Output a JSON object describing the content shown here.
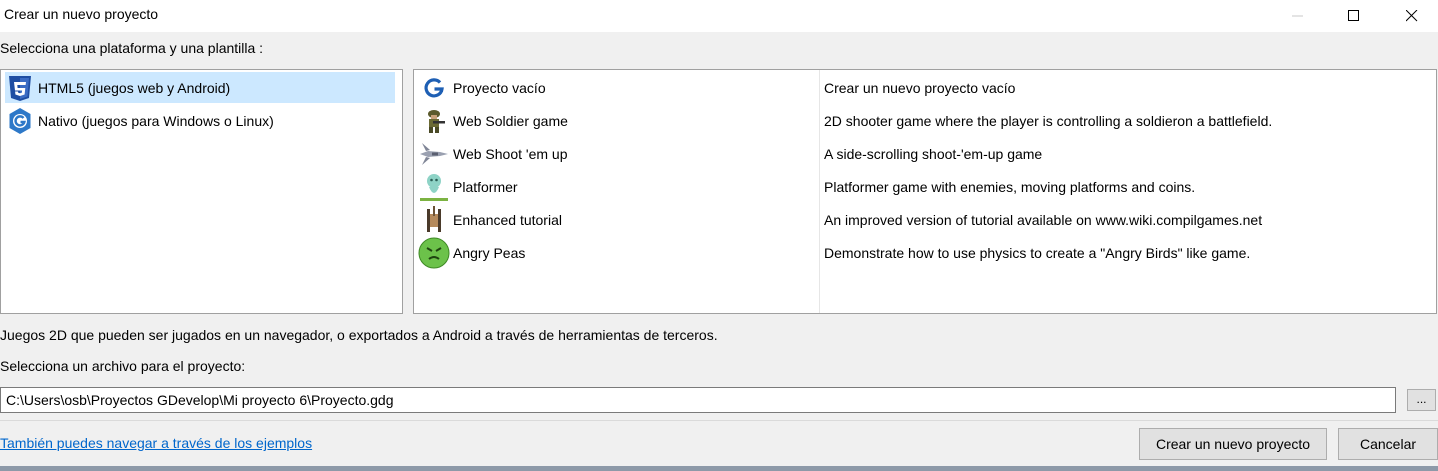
{
  "window": {
    "title": "Crear un nuevo proyecto"
  },
  "labels": {
    "choose_platform": "Selecciona una plataforma y una plantilla :",
    "platform_description": "Juegos 2D que pueden ser jugados en un navegador, o exportados a Android a través de herramientas de terceros.",
    "choose_file": "Selecciona un archivo para el proyecto:"
  },
  "platforms": [
    {
      "label": "HTML5 (juegos web y Android)",
      "icon": "html5-icon",
      "selected": true
    },
    {
      "label": "Nativo (juegos para Windows o Linux)",
      "icon": "gdevelop-native-icon",
      "selected": false
    }
  ],
  "templates": [
    {
      "name": "Proyecto vacío",
      "description": "Crear un nuevo proyecto vacío",
      "icon": "gdevelop-logo-icon"
    },
    {
      "name": "Web Soldier game",
      "description": "2D shooter game where the player is controlling a soldieron a battlefield.",
      "icon": "soldier-icon"
    },
    {
      "name": "Web Shoot 'em up",
      "description": "A side-scrolling shoot-'em-up game",
      "icon": "spaceship-icon"
    },
    {
      "name": "Platformer",
      "description": "Platformer game with enemies, moving platforms and coins.",
      "icon": "platformer-character-icon"
    },
    {
      "name": "Enhanced tutorial",
      "description": "An improved version of tutorial available on www.wiki.compilgames.net",
      "icon": "tutorial-tank-icon"
    },
    {
      "name": "Angry Peas",
      "description": "Demonstrate how to use physics to create a \"Angry Birds\" like game.",
      "icon": "angry-pea-icon"
    }
  ],
  "file": {
    "path": "C:\\Users\\osb\\Proyectos GDevelop\\Mi proyecto 6\\Proyecto.gdg",
    "browse_label": "..."
  },
  "footer": {
    "examples_link": "También puedes navegar a través de los ejemplos",
    "create_button": "Crear un nuevo proyecto",
    "cancel_button": "Cancelar"
  },
  "colors": {
    "selection": "#cce8ff",
    "link": "#0066cc",
    "window_bg": "#f0f0f0"
  }
}
